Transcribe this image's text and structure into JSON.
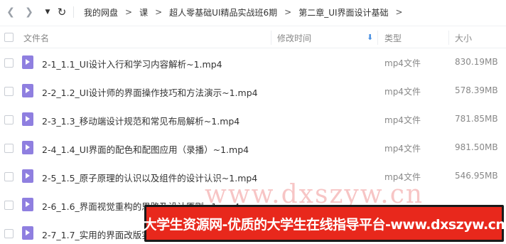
{
  "toolbar": {
    "back_icon": "chevron-left-icon",
    "forward_icon": "chevron-right-icon",
    "history_icon": "caret-down-icon",
    "refresh_icon": "refresh-icon"
  },
  "breadcrumb": [
    "我的网盘",
    "课",
    "超人零基础UI精品实战班6期",
    "第二章_UI界面设计基础"
  ],
  "breadcrumb_separator": ">",
  "columns": {
    "name": "文件名",
    "modified": "修改时间",
    "type": "类型",
    "size": "大小"
  },
  "sort": {
    "column": "modified",
    "direction": "descending",
    "icon": "arrow-down-icon"
  },
  "files": [
    {
      "name": "2-1_1.1_UI设计入行和学习内容解析~1.mp4",
      "type": "mp4文件",
      "size": "830.19MB"
    },
    {
      "name": "2-2_1.2_UI设计师的界面操作技巧和方法演示~1.mp4",
      "type": "mp4文件",
      "size": "578.39MB"
    },
    {
      "name": "2-3_1.3_移动端设计规范和常见布局解析~1.mp4",
      "type": "mp4文件",
      "size": "781.85MB"
    },
    {
      "name": "2-4_1.4_UI界面的配色和配图应用（录播）~1.mp4",
      "type": "mp4文件",
      "size": "981.50MB"
    },
    {
      "name": "2-5_1.5_原子原理的认识以及组件的设计认识~1.mp4",
      "type": "mp4文件",
      "size": "546.95MB"
    },
    {
      "name": "2-6_1.6_界面视觉重构的思路及设计原则~1.mp4",
      "type": "",
      "size": ""
    },
    {
      "name": "2-7_1.7_实用的界面改版实",
      "type": "",
      "size": ""
    }
  ],
  "watermark": "www.dxszyw.cn",
  "banner": "大学生资源网-优质的大学生在线指导平台-www.dxszyw.cn",
  "colors": {
    "file_icon": "#8f7fe0",
    "sort_accent": "#4a90e2",
    "banner_bg": "#e8281c",
    "banner_border": "#1a1a1a"
  }
}
